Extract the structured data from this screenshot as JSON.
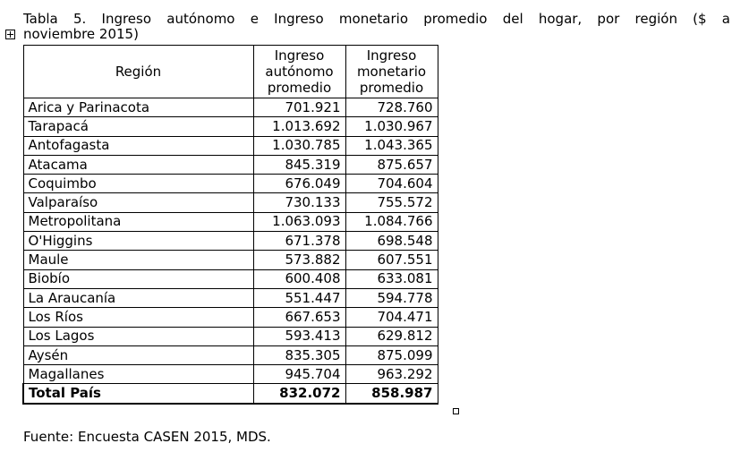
{
  "title": {
    "line1": "Tabla 5. Ingreso autónomo e Ingreso monetario promedio del hogar, por región ($ a",
    "line2": "noviembre 2015)"
  },
  "table": {
    "headers": {
      "region": "Región",
      "autonomo": [
        "Ingreso",
        "autónomo",
        "promedio"
      ],
      "monetario": [
        "Ingreso",
        "monetario",
        "promedio"
      ]
    },
    "rows": [
      {
        "region": "Arica y Parinacota",
        "autonomo": "701.921",
        "monetario": "728.760"
      },
      {
        "region": "Tarapacá",
        "autonomo": "1.013.692",
        "monetario": "1.030.967"
      },
      {
        "region": "Antofagasta",
        "autonomo": "1.030.785",
        "monetario": "1.043.365"
      },
      {
        "region": "Atacama",
        "autonomo": "845.319",
        "monetario": "875.657"
      },
      {
        "region": "Coquimbo",
        "autonomo": "676.049",
        "monetario": "704.604"
      },
      {
        "region": "Valparaíso",
        "autonomo": "730.133",
        "monetario": "755.572"
      },
      {
        "region": "Metropolitana",
        "autonomo": "1.063.093",
        "monetario": "1.084.766"
      },
      {
        "region": "O'Higgins",
        "autonomo": "671.378",
        "monetario": "698.548"
      },
      {
        "region": "Maule",
        "autonomo": "573.882",
        "monetario": "607.551"
      },
      {
        "region": "Biobío",
        "autonomo": "600.408",
        "monetario": "633.081"
      },
      {
        "region": "La Araucanía",
        "autonomo": "551.447",
        "monetario": "594.778"
      },
      {
        "region": "Los Ríos",
        "autonomo": "667.653",
        "monetario": "704.471"
      },
      {
        "region": "Los Lagos",
        "autonomo": "593.413",
        "monetario": "629.812"
      },
      {
        "region": "Aysén",
        "autonomo": "835.305",
        "monetario": "875.099"
      },
      {
        "region": "Magallanes",
        "autonomo": "945.704",
        "monetario": "963.292"
      }
    ],
    "total": {
      "region": "Total País",
      "autonomo": "832.072",
      "monetario": "858.987"
    }
  },
  "source": "Fuente: Encuesta CASEN 2015, MDS.",
  "icons": {
    "move_handle": "table-move-handle-icon",
    "resize_handle": "table-resize-handle-icon"
  }
}
